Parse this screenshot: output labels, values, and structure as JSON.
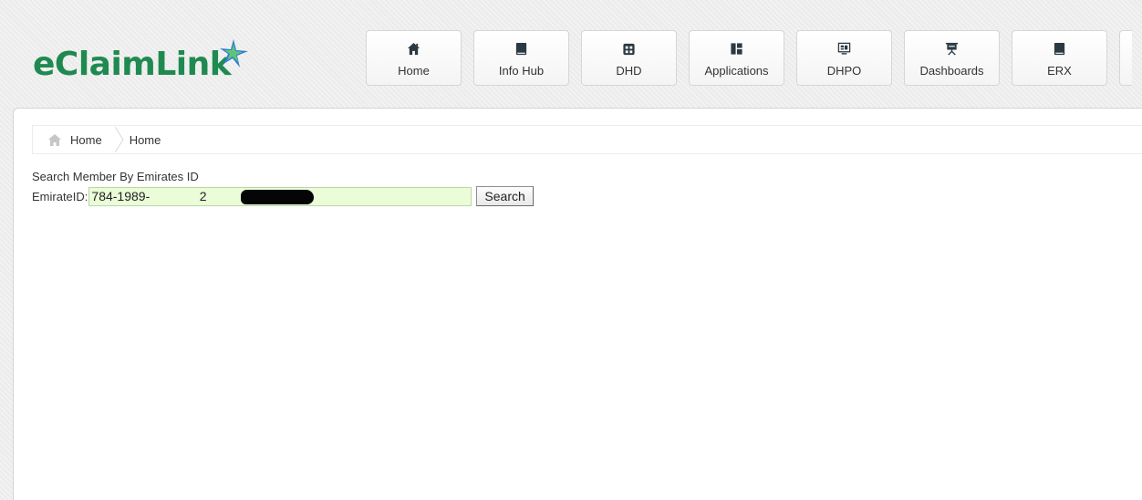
{
  "brand": {
    "name": "eClaimLink",
    "green": "#1f8a50",
    "accent_blue": "#2f7fd1"
  },
  "nav": {
    "items": [
      {
        "label": "Home",
        "icon": "home-icon"
      },
      {
        "label": "Info Hub",
        "icon": "book-icon"
      },
      {
        "label": "DHD",
        "icon": "hospital-icon"
      },
      {
        "label": "Applications",
        "icon": "apps-grid-icon"
      },
      {
        "label": "DHPO",
        "icon": "monitor-icon"
      },
      {
        "label": "Dashboards",
        "icon": "presentation-icon"
      },
      {
        "label": "ERX",
        "icon": "book-icon"
      }
    ]
  },
  "breadcrumb": {
    "home_label": "Home",
    "current": "Home"
  },
  "search": {
    "title": "Search Member By Emirates ID",
    "field_label": "EmirateID:",
    "value": "784-1989-              2",
    "button_label": "Search"
  }
}
